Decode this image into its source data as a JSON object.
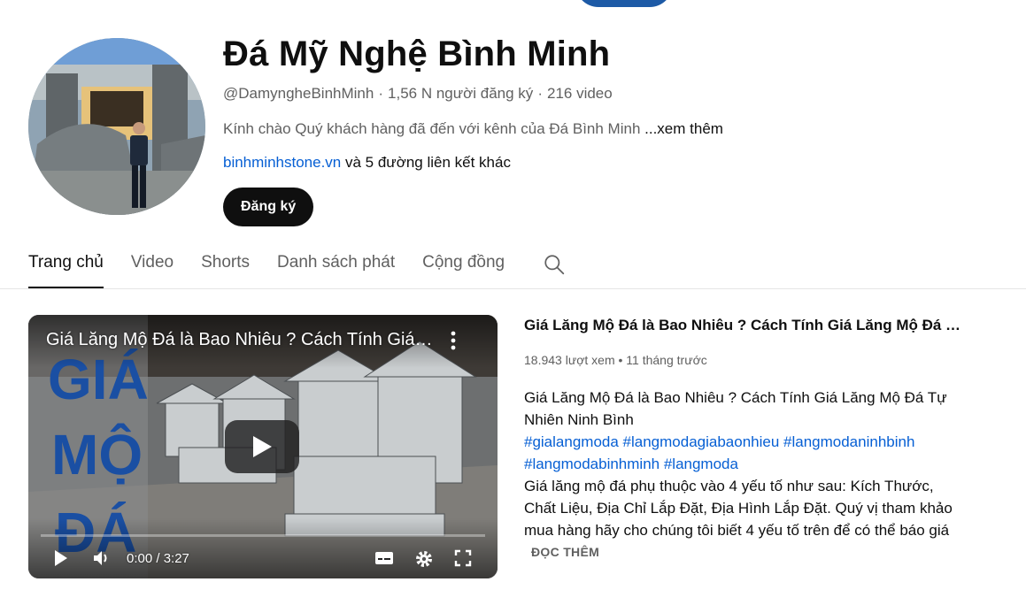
{
  "channel": {
    "name": "Đá Mỹ Nghệ Bình Minh",
    "handle": "@DamyngheBinhMinh",
    "subscribers": "1,56 N người đăng ký",
    "video_count": "216 video",
    "description": "Kính chào Quý khách hàng đã đến với kênh của Đá Bình Minh",
    "more_label": "...xem thêm",
    "link": "binhminhstone.vn",
    "other_links": "và 5 đường liên kết khác",
    "subscribe_label": "Đăng ký"
  },
  "tabs": [
    {
      "label": "Trang chủ"
    },
    {
      "label": "Video"
    },
    {
      "label": "Shorts"
    },
    {
      "label": "Danh sách phát"
    },
    {
      "label": "Cộng đồng"
    }
  ],
  "player": {
    "title": "Giá Lăng Mộ Đá là Bao Nhiêu ? Cách Tính Giá Lăng Mộ Đá Tự Nhiên Ninh Bình",
    "time": "0:00 / 3:27",
    "thumbnail_text": [
      "GIÁ",
      "MỘ",
      "ĐÁ"
    ],
    "progress": 0
  },
  "featured": {
    "title": "Giá Lăng Mộ Đá là Bao Nhiêu ? Cách Tính Giá Lăng Mộ Đá Tự Nhiên Ninh Bình",
    "views": "18.943 lượt xem",
    "age": "11 tháng trước",
    "desc_line1": "Giá Lăng Mộ Đá là Bao Nhiêu ? Cách Tính Giá Lăng Mộ Đá Tự Nhiên Ninh Bình",
    "hashtags": "#gialangmoda #langmodagiabaonhieu #langmodaninhbinh #langmodabinhminh #langmoda",
    "desc_body": "Giá lăng mộ đá phụ thuộc vào 4 yếu tố như sau: Kích Thước, Chất Liệu, Địa Chỉ Lắp Đặt, Địa Hình Lắp Đặt. Quý vị tham khảo mua hàng hãy cho chúng tôi biết 4 yếu tố trên để có thể báo giá",
    "read_more": "ĐỌC THÊM"
  },
  "colors": {
    "link": "#065fd4",
    "subscribe_bg": "#0f0f0f",
    "secondary_text": "#606060",
    "thumb_text": "#1a4fa3"
  }
}
